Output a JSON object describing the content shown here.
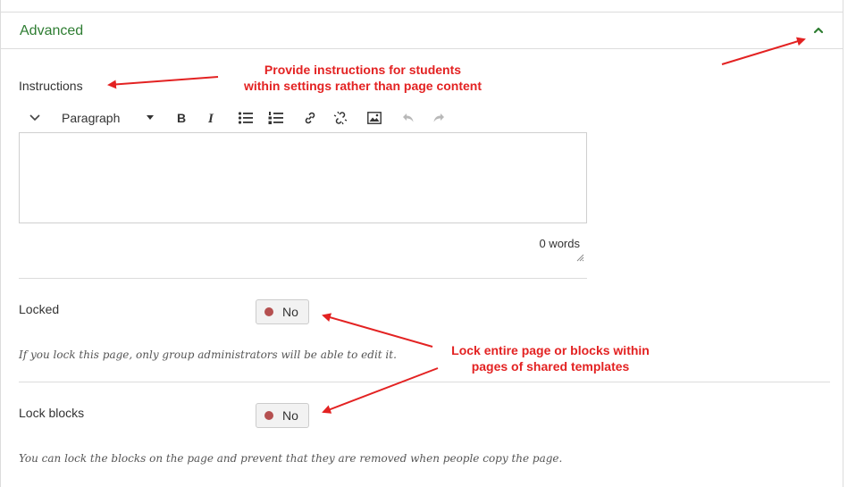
{
  "section": {
    "title": "Advanced"
  },
  "instructions": {
    "label": "Instructions",
    "toolbar": {
      "block_format": "Paragraph"
    },
    "word_count": "0 words"
  },
  "locked": {
    "label": "Locked",
    "toggle": "No",
    "help": "If you lock this page, only group administrators will be able to edit it."
  },
  "lock_blocks": {
    "label": "Lock blocks",
    "toggle": "No",
    "help": "You can lock the blocks on the page and prevent that they are removed when people copy the page."
  },
  "annotations": {
    "note1_line1": "Provide instructions for students",
    "note1_line2": "within settings rather than page content",
    "note2_line1": "Lock entire page or blocks within",
    "note2_line2": "pages of shared templates"
  },
  "colors": {
    "accent_green": "#2e7d32",
    "annotation_red": "#e32222",
    "toggle_dot": "#b55050"
  }
}
